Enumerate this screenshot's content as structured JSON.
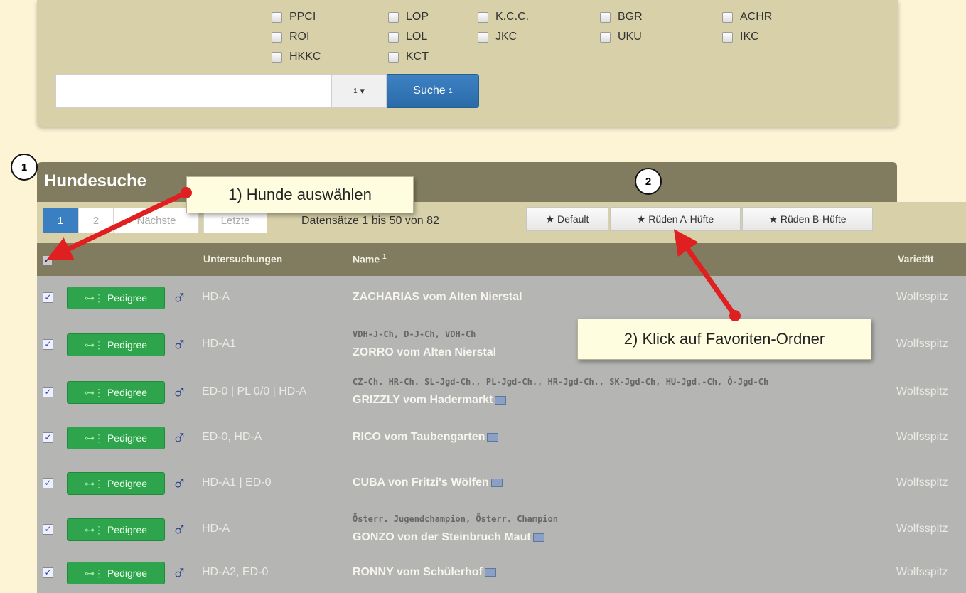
{
  "filters": {
    "col1": [
      "PPCI",
      "ROI",
      "HKKC"
    ],
    "col2": [
      "LOP",
      "LOL",
      "KCT"
    ],
    "col3": [
      "K.C.C.",
      "JKC"
    ],
    "col4": [
      "BGR",
      "UKU"
    ],
    "col5": [
      "ACHR",
      "IKC"
    ]
  },
  "search": {
    "input_value": "",
    "dropdown_label": "1",
    "button_label": "Suche",
    "button_sup": "1"
  },
  "results": {
    "title": "Hundesuche",
    "pagination": [
      "1",
      "2",
      "Nächste",
      "Letzte"
    ],
    "records_text": "Datensätze 1 bis 50 von 82",
    "favorites": [
      "★ Default",
      "★ Rüden A-Hüfte",
      "★ Rüden B-Hüfte"
    ],
    "columns": {
      "exams": "Untersuchungen",
      "name": "Name",
      "name_sup": "1",
      "variety": "Varietät"
    },
    "pedigree_label": "Pedigree",
    "male_symbol": "♂",
    "rows": [
      {
        "exam": "HD-A",
        "titles": "",
        "name": "ZACHARIAS vom Alten Nierstal",
        "photo": false,
        "variety": "Wolfsspitz"
      },
      {
        "exam": "HD-A1",
        "titles": "VDH-J-Ch, D-J-Ch, VDH-Ch",
        "name": "ZORRO vom Alten Nierstal",
        "photo": false,
        "variety": "Wolfsspitz"
      },
      {
        "exam": "ED-0 | PL 0/0 | HD-A",
        "titles": "CZ-Ch. HR-Ch. SL-Jgd-Ch., PL-Jgd-Ch., HR-Jgd-Ch., SK-Jgd-Ch, HU-Jgd.-Ch, Ö-Jgd-Ch",
        "name": "GRIZZLY vom Hadermarkt",
        "photo": true,
        "variety": "Wolfsspitz"
      },
      {
        "exam": "ED-0, HD-A",
        "titles": "",
        "name": "RICO vom Taubengarten",
        "photo": true,
        "variety": "Wolfsspitz"
      },
      {
        "exam": "HD-A1 | ED-0",
        "titles": "",
        "name": "CUBA von Fritzi's Wölfen",
        "photo": true,
        "variety": "Wolfsspitz"
      },
      {
        "exam": "HD-A",
        "titles": "Österr. Jugendchampion, Österr. Champion",
        "name": "GONZO von der Steinbruch Maut",
        "photo": true,
        "variety": "Wolfsspitz"
      },
      {
        "exam": "HD-A2, ED-0",
        "titles": "",
        "name": "RONNY vom Schülerhof",
        "photo": true,
        "variety": "Wolfsspitz"
      }
    ]
  },
  "annotations": {
    "callout1": "1) Hunde auswählen",
    "callout2": "2) Klick auf Favoriten-Ordner",
    "marker1": "1",
    "marker2": "2",
    "arrow_color": "#e02020"
  }
}
